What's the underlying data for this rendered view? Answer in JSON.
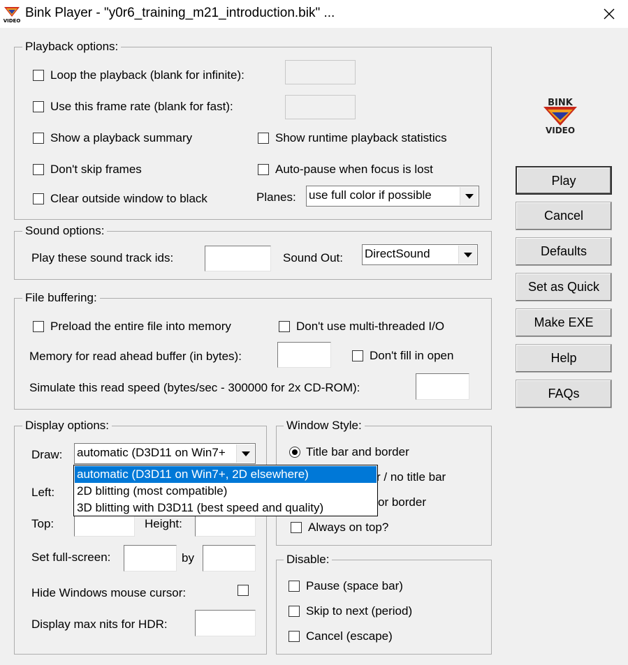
{
  "window": {
    "title": "Bink Player - \"y0r6_training_m21_introduction.bik\" ...",
    "logo_text_top": "BINK",
    "logo_text_bottom": "VIDEO"
  },
  "playback": {
    "group_label": "Playback options:",
    "loop_label": "Loop the playback (blank for infinite):",
    "frame_rate_label": "Use this frame rate (blank for fast):",
    "summary_label": "Show a playback summary",
    "runtime_stats_label": "Show runtime playback statistics",
    "dont_skip_label": "Don't skip frames",
    "autopause_label": "Auto-pause when focus is lost",
    "clear_outside_label": "Clear outside window to black",
    "planes_label": "Planes:",
    "planes_value": "use full color if possible"
  },
  "sound": {
    "group_label": "Sound options:",
    "track_ids_label": "Play these sound track ids:",
    "sound_out_label": "Sound Out:",
    "sound_out_value": "DirectSound"
  },
  "buffering": {
    "group_label": "File buffering:",
    "preload_label": "Preload the entire file into memory",
    "no_multithread_label": "Don't use multi-threaded I/O",
    "read_ahead_label": "Memory for read ahead buffer (in bytes):",
    "dont_fill_label": "Don't fill in open",
    "simulate_label": "Simulate this read speed (bytes/sec - 300000 for 2x CD-ROM):"
  },
  "display": {
    "group_label": "Display options:",
    "draw_label": "Draw:",
    "draw_value": "automatic (D3D11 on Win7+",
    "draw_options": [
      "automatic (D3D11 on Win7+, 2D elsewhere)",
      "2D blitting (most compatible)",
      "3D blitting with D3D11 (best speed and quality)"
    ],
    "left_label": "Left:",
    "top_label": "Top:",
    "height_label": "Height:",
    "fullscreen_label": "Set full-screen:",
    "by_label": "by",
    "hide_cursor_label": "Hide Windows mouse cursor:",
    "max_nits_label": "Display max nits for HDR:"
  },
  "window_style": {
    "group_label": "Window Style:",
    "title_border_label": "Title bar and border",
    "no_title_partial": "r / no title bar",
    "no_border_partial": "or border",
    "always_on_top_label": "Always on top?"
  },
  "disable": {
    "group_label": "Disable:",
    "pause_label": "Pause (space bar)",
    "skip_label": "Skip to next (period)",
    "cancel_label": "Cancel (escape)"
  },
  "buttons": {
    "play": "Play",
    "cancel": "Cancel",
    "defaults": "Defaults",
    "set_quick": "Set as Quick",
    "make_exe": "Make EXE",
    "help": "Help",
    "faqs": "FAQs"
  }
}
